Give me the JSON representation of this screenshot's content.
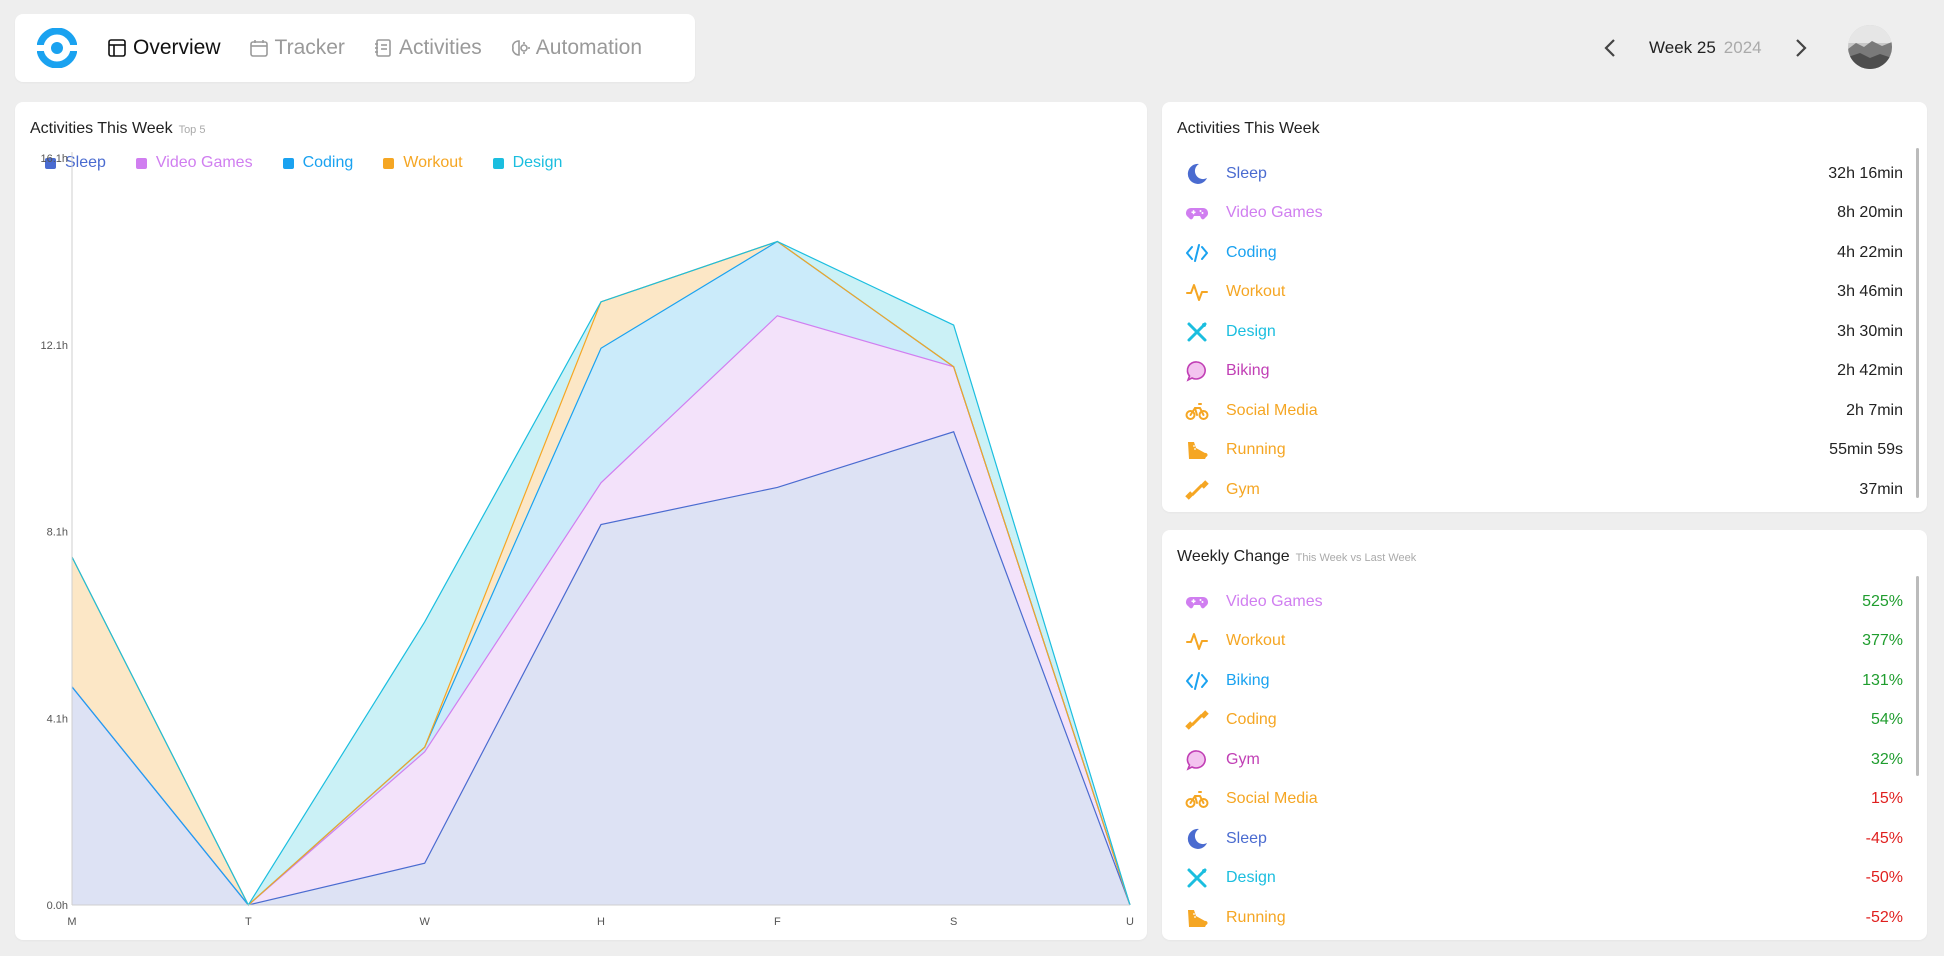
{
  "nav": {
    "items": [
      {
        "label": "Overview",
        "icon": "layout-icon",
        "active": true
      },
      {
        "label": "Tracker",
        "icon": "calendar-icon",
        "active": false
      },
      {
        "label": "Activities",
        "icon": "notebook-icon",
        "active": false
      },
      {
        "label": "Automation",
        "icon": "brain-gear-icon",
        "active": false
      }
    ]
  },
  "week": {
    "label": "Week 25",
    "year": "2024"
  },
  "chart_card": {
    "title": "Activities This Week",
    "subtitle": "Top 5"
  },
  "chart_data": {
    "type": "area",
    "stacked": true,
    "x": [
      "M",
      "T",
      "W",
      "H",
      "F",
      "S",
      "U"
    ],
    "y_ticks": [
      "0.0h",
      "4.1h",
      "8.1h",
      "12.1h",
      "16.1h"
    ],
    "ylim": [
      0,
      16.1
    ],
    "grid": false,
    "legend_placement": "top-left",
    "series": [
      {
        "name": "Sleep",
        "color": "#4a6bd0",
        "fill": "#dde2f4",
        "values": [
          4.7,
          0,
          0.9,
          8.2,
          9.0,
          10.2,
          0
        ]
      },
      {
        "name": "Video Games",
        "color": "#d07ef0",
        "fill": "#f3e2fa",
        "values": [
          0,
          0,
          2.4,
          0.9,
          3.7,
          1.4,
          0
        ]
      },
      {
        "name": "Coding",
        "color": "#1aa2f0",
        "fill": "#cbebfa",
        "values": [
          0,
          0,
          0.1,
          2.9,
          1.6,
          0,
          0
        ]
      },
      {
        "name": "Workout",
        "color": "#f5a623",
        "fill": "#fce7c6",
        "values": [
          2.8,
          0,
          0,
          1.0,
          0,
          0,
          0
        ]
      },
      {
        "name": "Design",
        "color": "#1bbedf",
        "fill": "#cbf1f6",
        "values": [
          0,
          0,
          2.7,
          0,
          0,
          0.9,
          0
        ]
      }
    ]
  },
  "activities": {
    "title": "Activities This Week",
    "items": [
      {
        "name": "Sleep",
        "value": "32h 16min",
        "color": "#4a6bd0",
        "icon": "moon-icon"
      },
      {
        "name": "Video Games",
        "value": "8h 20min",
        "color": "#d07ef0",
        "icon": "gamepad-icon"
      },
      {
        "name": "Coding",
        "value": "4h 22min",
        "color": "#1aa2f0",
        "icon": "code-icon"
      },
      {
        "name": "Workout",
        "value": "3h 46min",
        "color": "#f5a623",
        "icon": "pulse-icon"
      },
      {
        "name": "Design",
        "value": "3h 30min",
        "color": "#1bbedf",
        "icon": "design-tools-icon"
      },
      {
        "name": "Biking",
        "value": "2h 42min",
        "color": "#c13fb5",
        "icon": "chat-bubble-icon"
      },
      {
        "name": "Social Media",
        "value": "2h 7min",
        "color": "#f5a623",
        "icon": "bicycle-icon"
      },
      {
        "name": "Running",
        "value": "55min 59s",
        "color": "#f5a623",
        "icon": "running-shoe-icon"
      },
      {
        "name": "Gym",
        "value": "37min",
        "color": "#f5a623",
        "icon": "dumbbell-icon"
      }
    ]
  },
  "weekly_change": {
    "title": "Weekly Change",
    "subtitle": "This Week vs Last Week",
    "items": [
      {
        "name": "Video Games",
        "value": "525%",
        "color": "#d07ef0",
        "icon": "gamepad-icon",
        "value_color": "#1f9d2e"
      },
      {
        "name": "Workout",
        "value": "377%",
        "color": "#f5a623",
        "icon": "pulse-icon",
        "value_color": "#1f9d2e"
      },
      {
        "name": "Biking",
        "value": "131%",
        "color": "#1aa2f0",
        "icon": "code-icon",
        "value_color": "#1f9d2e"
      },
      {
        "name": "Coding",
        "value": "54%",
        "color": "#f5a623",
        "icon": "dumbbell-icon",
        "value_color": "#1f9d2e"
      },
      {
        "name": "Gym",
        "value": "32%",
        "color": "#c13fb5",
        "icon": "chat-bubble-icon",
        "value_color": "#1f9d2e"
      },
      {
        "name": "Social Media",
        "value": "15%",
        "color": "#f5a623",
        "icon": "bicycle-icon",
        "value_color": "#e0201f"
      },
      {
        "name": "Sleep",
        "value": "-45%",
        "color": "#4a6bd0",
        "icon": "moon-icon",
        "value_color": "#e0201f"
      },
      {
        "name": "Design",
        "value": "-50%",
        "color": "#1bbedf",
        "icon": "design-tools-icon",
        "value_color": "#e0201f"
      },
      {
        "name": "Running",
        "value": "-52%",
        "color": "#f5a623",
        "icon": "running-shoe-icon",
        "value_color": "#e0201f"
      }
    ]
  }
}
